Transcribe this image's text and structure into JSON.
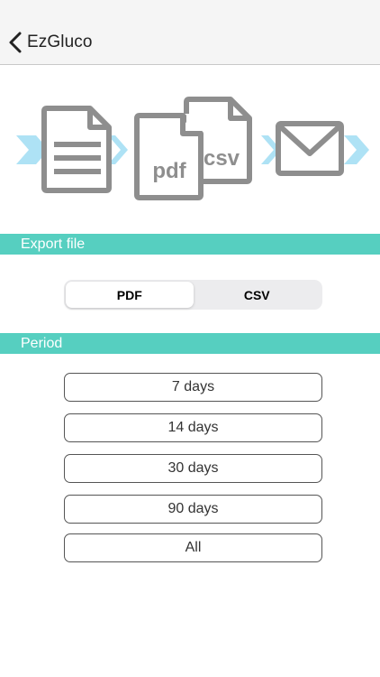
{
  "app": {
    "title": "EzGluco"
  },
  "navbar": {
    "back_label": "EzGluco",
    "back_icon": "chevron-left-icon"
  },
  "illustration": {
    "pdf_label": "pdf",
    "csv_label": "csv",
    "icons": [
      "document-icon",
      "pdf-file-icon",
      "csv-file-icon",
      "envelope-icon",
      "arrow-chevron-icon"
    ],
    "icon_color": "#8e8e8e",
    "arrow_color": "#aee2f5"
  },
  "export_section": {
    "header": "Export file",
    "options": [
      {
        "label": "PDF",
        "selected": true
      },
      {
        "label": "CSV",
        "selected": false
      }
    ]
  },
  "period_section": {
    "header": "Period",
    "options": [
      {
        "label": "7 days"
      },
      {
        "label": "14 days"
      },
      {
        "label": "30 days"
      },
      {
        "label": "90 days"
      },
      {
        "label": "All"
      }
    ]
  },
  "colors": {
    "section_header_bg": "#56cfc0",
    "navbar_bg": "#f5f5f5",
    "button_border": "#555555"
  }
}
